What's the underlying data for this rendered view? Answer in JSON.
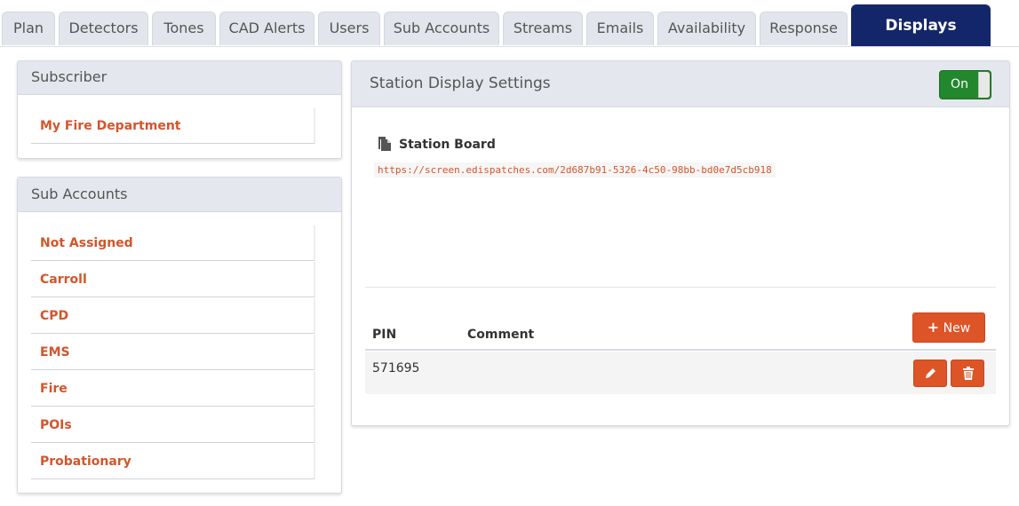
{
  "tabs": [
    {
      "label": "Plan"
    },
    {
      "label": "Detectors"
    },
    {
      "label": "Tones"
    },
    {
      "label": "CAD Alerts"
    },
    {
      "label": "Users"
    },
    {
      "label": "Sub Accounts"
    },
    {
      "label": "Streams"
    },
    {
      "label": "Emails"
    },
    {
      "label": "Availability"
    },
    {
      "label": "Response"
    },
    {
      "label": "Displays"
    }
  ],
  "active_tab": "Displays",
  "subscriber": {
    "title": "Subscriber",
    "items": [
      {
        "label": "My Fire Department"
      }
    ]
  },
  "sub_accounts": {
    "title": "Sub Accounts",
    "items": [
      {
        "label": "Not Assigned"
      },
      {
        "label": "Carroll"
      },
      {
        "label": "CPD"
      },
      {
        "label": "EMS"
      },
      {
        "label": "Fire"
      },
      {
        "label": "POIs"
      },
      {
        "label": "Probationary"
      }
    ]
  },
  "display_settings": {
    "title": "Station Display Settings",
    "toggle_label": "On",
    "toggle_on": true,
    "board_title": "Station Board",
    "board_url": "https://screen.edispatches.com/2d687b91-5326-4c50-98bb-bd0e7d5cb918",
    "new_button_label": "New",
    "table": {
      "columns": [
        "PIN",
        "Comment"
      ],
      "rows": [
        {
          "pin": "571695",
          "comment": ""
        }
      ]
    }
  },
  "colors": {
    "accent": "#dd5427",
    "active_tab": "#14266a",
    "toggle_on": "#23872d",
    "link": "#d4552b"
  }
}
